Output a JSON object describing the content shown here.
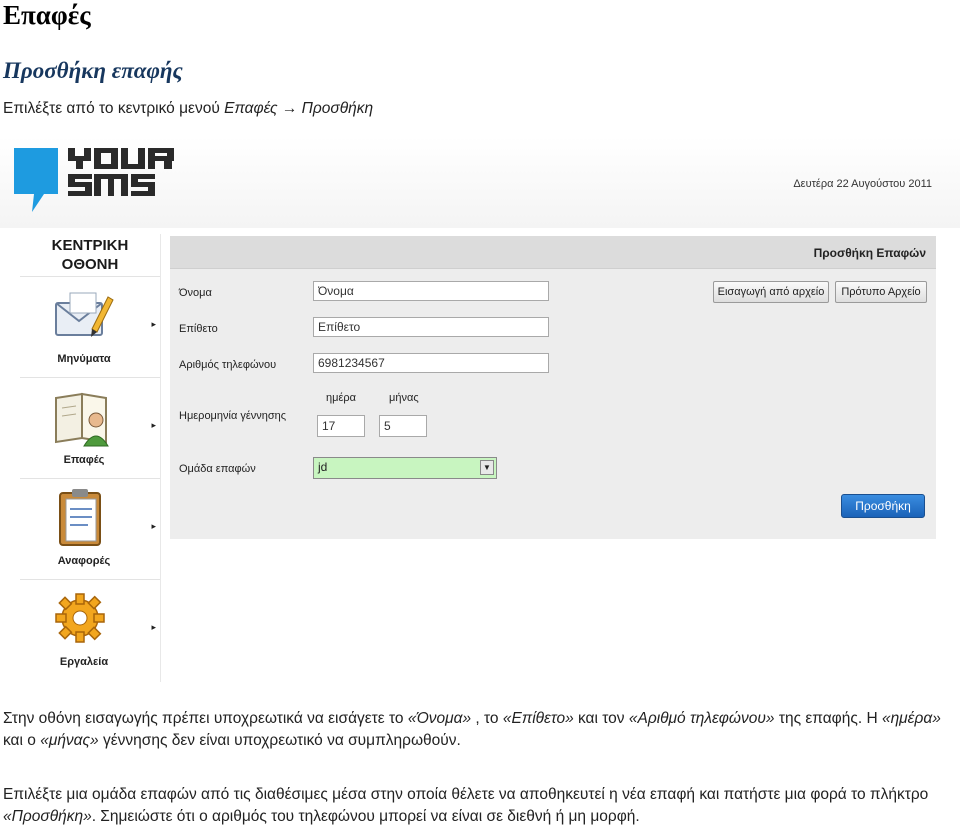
{
  "doc": {
    "heading": "Επαφές",
    "subheading": "Προσθήκη επαφής",
    "intro_prefix": "Επιλέξτε από το κεντρικό μενού ",
    "intro_path1": "Επαφές",
    "intro_arrow": "→",
    "intro_path2": "Προσθήκη",
    "p2_a": "Στην οθόνη εισαγωγής πρέπει υποχρεωτικά να εισάγετε το ",
    "p2_b": "«Όνομα»",
    "p2_c": " , το ",
    "p2_d": "«Επίθετο»",
    "p2_e": " και τον ",
    "p2_f": "«Αριθμό τηλεφώνου»",
    "p2_g": " της επαφής. Η ",
    "p2_h": "«ημέρα»",
    "p2_i": " και ο ",
    "p2_j": "«μήνας»",
    "p2_k": " γέννησης δεν είναι υποχρεωτικό να συμπληρωθούν.",
    "p3_a": "Επιλέξτε μια ομάδα επαφών από τις διαθέσιμες μέσα στην οποία θέλετε να αποθηκευτεί η νέα επαφή και πατήστε μια φορά το πλήκτρο ",
    "p3_b": "«Προσθήκη»",
    "p3_c": ". Σημειώστε ότι ο αριθμός του τηλεφώνου μπορεί να είναι σε διεθνή ή μη μορφή."
  },
  "app": {
    "logo_line1": "YOUR",
    "logo_line2": "SMS",
    "date": "Δευτέρα 22 Αυγούστου 2011",
    "sidebar": {
      "title_line1": "ΚΕΝΤΡΙΚΗ",
      "title_line2": "ΟΘΟΝΗ",
      "items": [
        {
          "label": "Μηνύματα",
          "icon": "envelope-pencil-icon"
        },
        {
          "label": "Επαφές",
          "icon": "contacts-book-icon"
        },
        {
          "label": "Αναφορές",
          "icon": "clipboard-icon"
        },
        {
          "label": "Εργαλεία",
          "icon": "gear-icon"
        }
      ],
      "arrow": "▸"
    },
    "panel_title": "Προσθήκη Επαφών",
    "form": {
      "first_name_label": "Όνομα",
      "first_name_value": "Όνομα",
      "last_name_label": "Επίθετο",
      "last_name_value": "Επίθετο",
      "phone_label": "Αριθμός τηλεφώνου",
      "phone_value": "6981234567",
      "birth_label": "Ημερομηνία γέννησης",
      "day_label": "ημέρα",
      "day_value": "17",
      "month_label": "μήνας",
      "month_value": "5",
      "group_label": "Ομάδα επαφών",
      "group_value": "jd"
    },
    "buttons": {
      "import_file": "Εισαγωγή από αρχείο",
      "template_file": "Πρότυπο Αρχείο",
      "add": "Προσθήκη"
    },
    "colors": {
      "logo_blue": "#1e9be0",
      "select_green": "#c8f5c0",
      "add_button_blue": "#1a62b8"
    }
  }
}
